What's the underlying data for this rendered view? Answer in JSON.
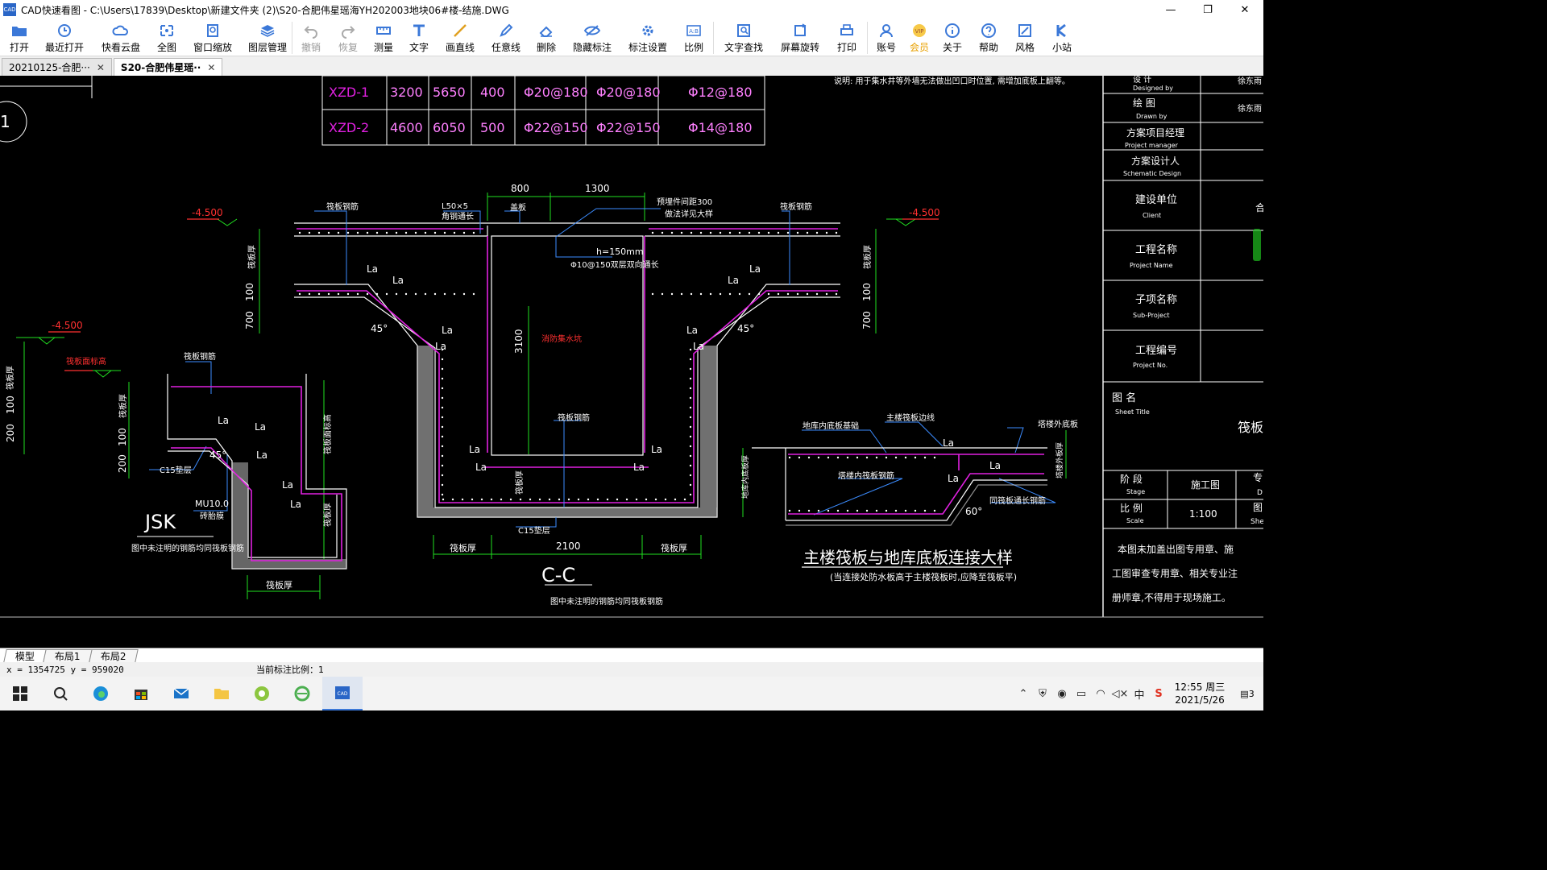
{
  "window": {
    "title": "CAD快速看图 - C:\\Users\\17839\\Desktop\\新建文件夹 (2)\\S20-合肥伟星瑶海YH202003地块06#楼-结施.DWG",
    "app_icon_text": "CAD",
    "minimize": "—",
    "restore": "❐",
    "close": "✕"
  },
  "toolbar": {
    "open": "打开",
    "recent": "最近打开",
    "cloud": "快看云盘",
    "fullview": "全图",
    "window_zoom": "窗口缩放",
    "layers": "图层管理",
    "undo": "撤销",
    "redo": "恢复",
    "measure": "测量",
    "text": "文字",
    "line": "画直线",
    "freeline": "任意线",
    "delete": "删除",
    "hide_marks": "隐藏标注",
    "mark_settings": "标注设置",
    "ratio": "比例",
    "text_search": "文字查找",
    "rotate": "屏幕旋转",
    "print": "打印",
    "account": "账号",
    "vip": "会员",
    "about": "关于",
    "help": "帮助",
    "style": "风格",
    "station": "小站",
    "ratio_icon_text": "A:B",
    "vip_icon_text": "VIP"
  },
  "tabs": [
    {
      "label": "20210125-合肥···",
      "close": "✕"
    },
    {
      "label": "S20-合肥伟星瑶··",
      "close": "✕"
    }
  ],
  "drawing": {
    "table_rows": [
      {
        "id": "XZD-1",
        "c1": "3200",
        "c2": "5650",
        "c3": "400",
        "c4": "Φ20@180",
        "c5": "Φ20@180",
        "c6": "Φ12@180"
      },
      {
        "id": "XZD-2",
        "c1": "4600",
        "c2": "6050",
        "c3": "500",
        "c4": "Φ22@150",
        "c5": "Φ22@150",
        "c6": "Φ14@180"
      }
    ],
    "note_top": "说明: 用于集水井等外墙无法做出凹口时位置, 需增加底板上翻等。",
    "circle_label": "1",
    "dim_800": "800",
    "dim_1300": "1300",
    "dim_3100": "3100",
    "dim_2100": "2100",
    "dim_700": "700",
    "dim_100": "100",
    "dim_200": "200",
    "elev": "-4.500",
    "label_l50": "L50×5",
    "label_l50_sub": "角钢通长",
    "label_gaiban": "盖板",
    "label_ymj": "预埋件间距300",
    "label_ymj_sub": "做法详见大样",
    "label_h150": "h=150mm",
    "label_bars": "Φ10@150双层双向通长",
    "label_fbgj": "筏板钢筋",
    "label_fbh": "筏板厚",
    "label_fbmd": "筏板面标高",
    "label_jsj": "消防集水坑",
    "label_c15": "C15垫层",
    "label_mu10": "MU10.0",
    "label_mu10_sub": "砖胎膜",
    "label_angle45": "45°",
    "label_angle60": "60°",
    "label_la": "La",
    "label_jsk": "JSK",
    "note_jsk": "图中未注明的钢筋均同筏板钢筋",
    "label_cc": "C-C",
    "note_cc": "图中未注明的钢筋均同筏板钢筋",
    "detail_title": "主楼筏板与地库底板连接大样",
    "detail_sub": "(当连接处防水板高于主楼筏板时,应降至筏板平)",
    "label_dkdb": "地库内底板基础",
    "label_zlfb": "主楼筏板边线",
    "label_zlfb2": "塔楼内筏板钢筋",
    "label_fbxj": "塔楼外底板",
    "label_tgjs": "同筏板通长钢筋",
    "label_fbh2": "地库内底板厚",
    "label_fbh3": "塔楼外板厚"
  },
  "titleblock": {
    "designed_cn": "设  计",
    "designed_en": "Designed by",
    "designed_val": "徐东雨",
    "drawn_cn": "绘  图",
    "drawn_en": "Drawn by",
    "drawn_val": "徐东雨",
    "pm_cn": "方案项目经理",
    "pm_en": "Project manager",
    "sd_cn": "方案设计人",
    "sd_en": "Schematic  Design",
    "client_cn": "建设单位",
    "client_en": "Client",
    "client_val": "合",
    "proj_cn": "工程名称",
    "proj_en": "Project Name",
    "sub_cn": "子项名称",
    "sub_en": "Sub-Project",
    "pno_cn": "工程编号",
    "pno_en": "Project No.",
    "sheet_cn": "图  名",
    "sheet_en": "Sheet Title",
    "sheet_val": "筏板",
    "stage_cn": "阶  段",
    "stage_en": "Stage",
    "stage_val": "施工图",
    "stage_extra": "专",
    "stage_extra2": "D",
    "scale_cn": "比  例",
    "scale_en": "Scale",
    "scale_val": "1:100",
    "scale_extra": "图",
    "scale_extra2": "She",
    "note_line1": "本图未加盖出图专用章、施",
    "note_line2": "工图审查专用章、相关专业注",
    "note_line3": "册师章,不得用于现场施工。"
  },
  "layout_tabs": [
    "模型",
    "布局1",
    "布局2"
  ],
  "status": {
    "coords": "x = 1354725  y = 959020",
    "scale": "当前标注比例：1"
  },
  "tray": {
    "time": "12:55 周三",
    "date": "2021/5/26",
    "ime": "中",
    "notifications": "3"
  }
}
